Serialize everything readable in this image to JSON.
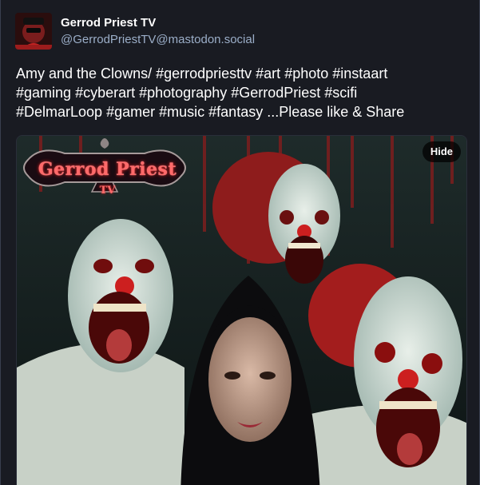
{
  "post": {
    "display_name": "Gerrod Priest TV",
    "account": "@GerrodPriestTV@mastodon.social",
    "text_parts": [
      "Amy and the Clowns/ ",
      "#gerrodpriesttv",
      " ",
      "#art",
      " ",
      "#photo",
      " ",
      "#instaart",
      " ",
      "#gaming",
      " ",
      "#cyberart",
      " ",
      "#photography",
      " ",
      "#GerrodPriest",
      " ",
      "#scifi",
      " ",
      "#DelmarLoop",
      " ",
      "#gamer",
      " ",
      "#music",
      " ",
      "#fantasy",
      " ...Please like & Share"
    ]
  },
  "media": {
    "hide_label": "Hide",
    "logo_line1": "Gerrod Priest",
    "logo_line2": "TV"
  },
  "icons": {
    "avatar": "avatar-icon"
  },
  "colors": {
    "background": "#191b22",
    "text": "#ffffff",
    "secondary": "#9baec8"
  }
}
